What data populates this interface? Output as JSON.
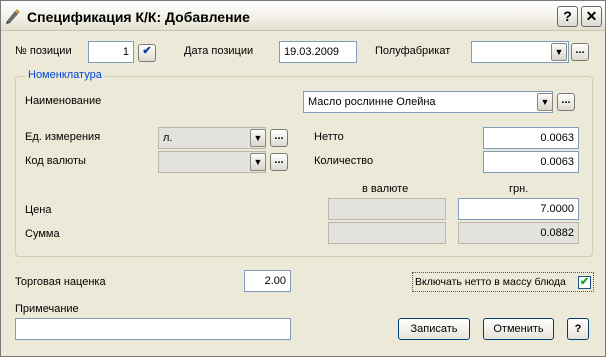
{
  "window": {
    "title": "Спецификация К/К: Добавление",
    "help_btn": "?",
    "close_btn": "✕"
  },
  "top": {
    "pos_label": "№ позиции",
    "pos_value": "1",
    "date_label": "Дата позиции",
    "date_value": "19.03.2009",
    "semi_label": "Полуфабрикат",
    "semi_value": ""
  },
  "nomen": {
    "group_title": "Номенклатура",
    "name_label": "Наименование",
    "name_value": "Масло рослинне Олейна",
    "unit_label": "Ед. измерения",
    "unit_value": "л.",
    "currency_label": "Код валюты",
    "currency_value": "",
    "netto_label": "Нетто",
    "netto_value": "0.0063",
    "qty_label": "Количество",
    "qty_value": "0.0063",
    "col_currency": "в валюте",
    "col_uah": "грн.",
    "price_label": "Цена",
    "price_currency": "",
    "price_uah": "7.0000",
    "sum_label": "Сумма",
    "sum_currency": "",
    "sum_uah": "0.0882"
  },
  "bottom": {
    "markup_label": "Торговая наценка",
    "markup_value": "2.00",
    "netto_check_label": "Включать нетто в массу блюда",
    "netto_check": true,
    "note_label": "Примечание",
    "note_value": "",
    "save_btn": "Записать",
    "cancel_btn": "Отменить",
    "help_btn": "?"
  }
}
